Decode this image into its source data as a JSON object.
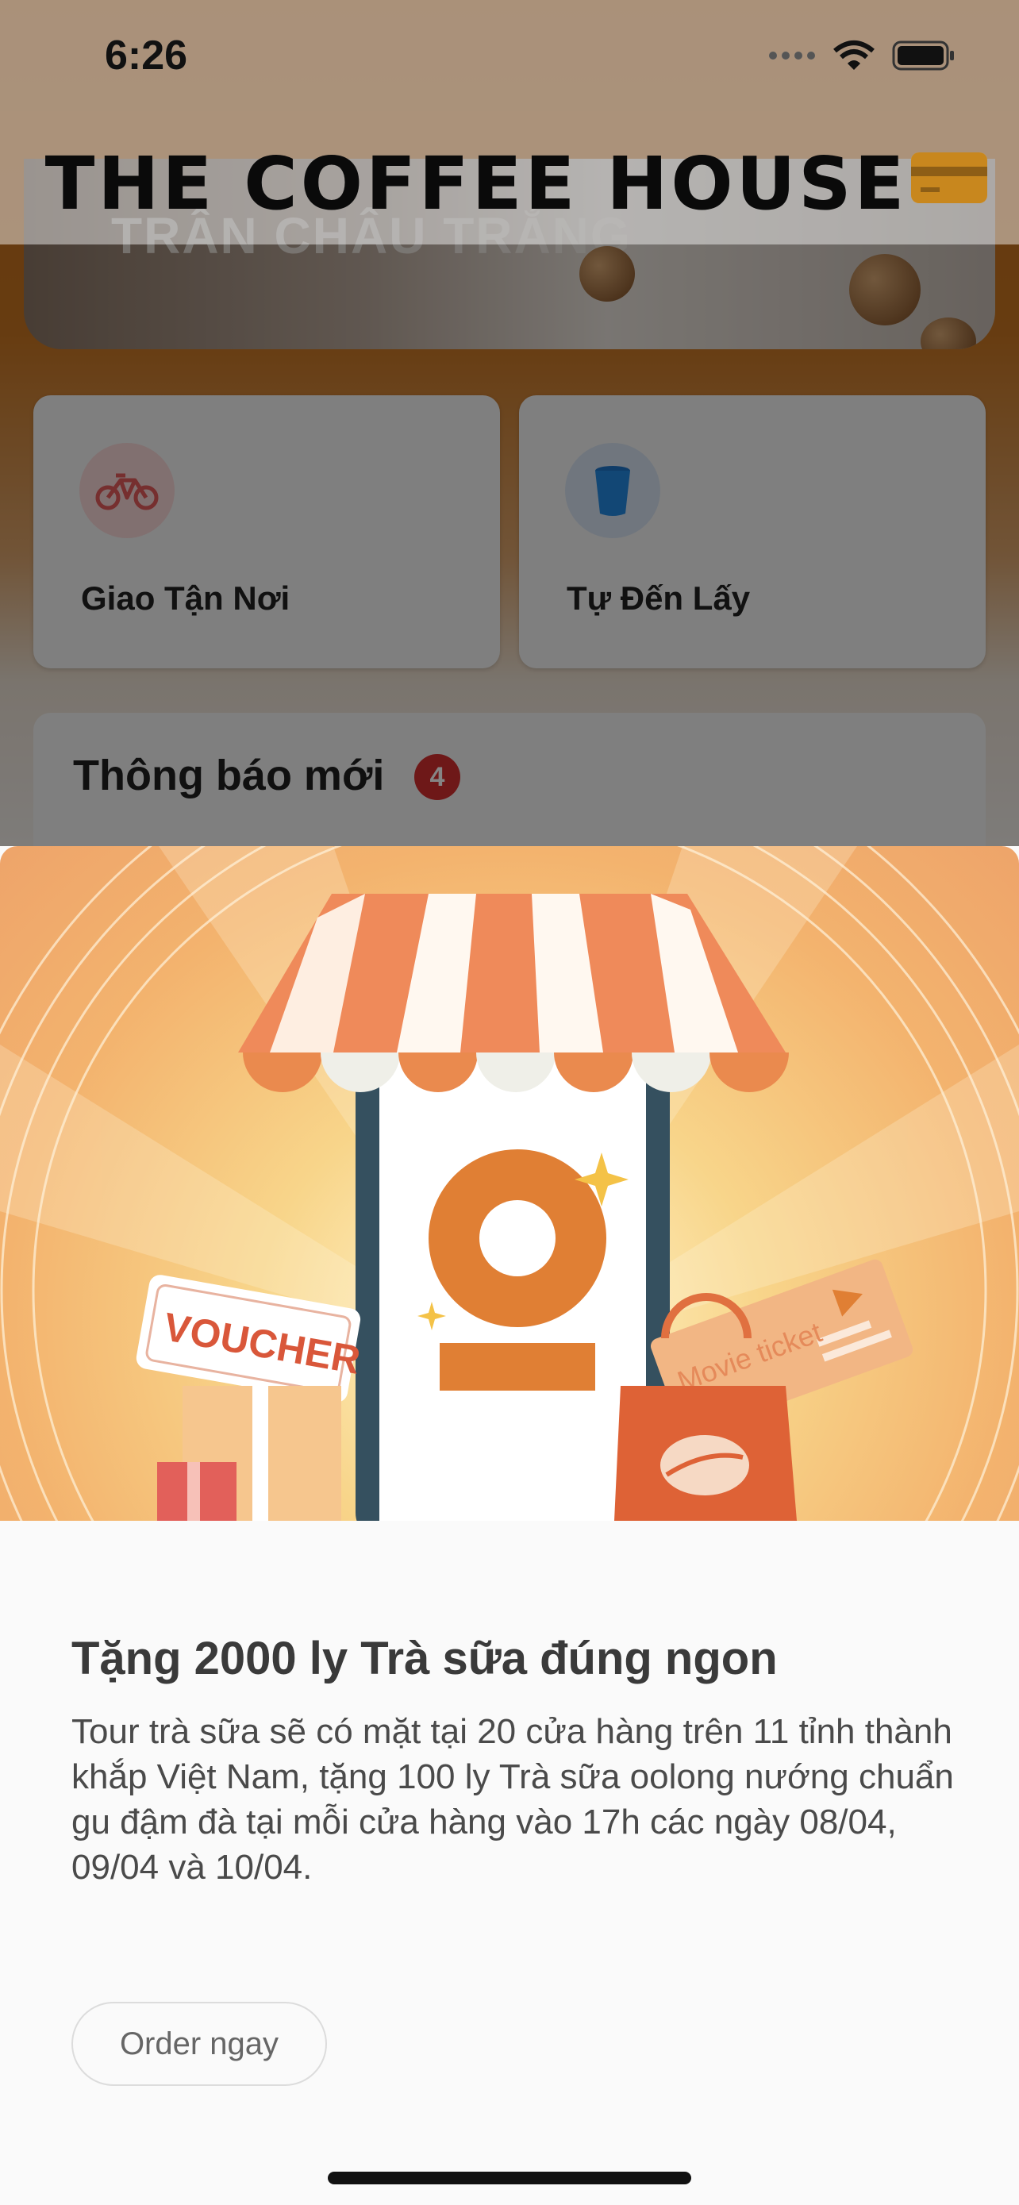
{
  "status_bar": {
    "time": "6:26"
  },
  "header": {
    "logo_text": "THE COFFEE HOUSE",
    "brand_color": "#c8871e"
  },
  "background": {
    "banner_text": "TRÂN CHÂU TRẮNG",
    "order_options": [
      {
        "label": "Giao Tận Nơi",
        "icon": "bicycle-icon"
      },
      {
        "label": "Tự Đến Lấy",
        "icon": "cup-icon"
      }
    ],
    "notifications": {
      "title": "Thông báo mới",
      "count": "4"
    }
  },
  "promo": {
    "image_texts": {
      "voucher": "VOUCHER",
      "ticket": "Movie ticket"
    },
    "title": "Tặng 2000 ly Trà sữa đúng ngon",
    "description": "Tour trà sữa sẽ có mặt tại 20 cửa hàng trên 11 tỉnh thành khắp Việt Nam, tặng 100 ly Trà sữa oolong nướng chuẩn gu đậm đà tại mỗi cửa hàng vào 17h các ngày 08/04, 09/04 và 10/04.",
    "cta_label": "Order ngay"
  }
}
